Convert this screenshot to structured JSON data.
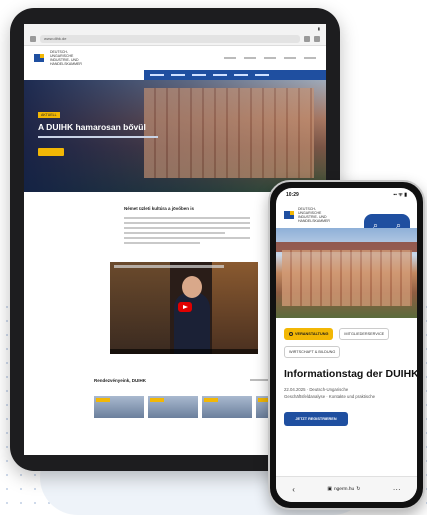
{
  "tablet": {
    "url": "www.dihk.de",
    "logo_text": "DEUTSCH-UNGARISCHE INDUSTRIE- UND HANDELSKAMMER",
    "hero_badge": "AKTUELL",
    "hero_title": "A DUIHK hamarosan bővül",
    "content_heading": "Német üzleti kultúra a jövőben is",
    "section_title": "Rendezvényeink, DUIHK"
  },
  "phone": {
    "time": "10:29",
    "signal": "▪▪ ᯤ ▮",
    "logo_text": "DEUTSCH-UNGARISCHE INDUSTRIE- UND HANDELSKAMMER",
    "search_icon": "⌕",
    "search_icon2": "⌕",
    "tag_active": "VERANSTALTUNG",
    "tag_2": "MITGLIEDERSERVICE",
    "tag_3": "WIRTSCHAFT & BILDUNG",
    "title": "Informationstag der DUIHK",
    "desc_line1": "22.04.2025 · Deutsch-Ungarische",
    "desc_line2": "Geschäftsfeldanalyse · Kontakte und praktische",
    "button_label": "JETZT REGISTRIEREN",
    "browser_back": "‹",
    "browser_url": "ngerm.hu",
    "browser_reload": "↻",
    "browser_more": "···"
  },
  "colors": {
    "brand_blue": "#1f4fa0",
    "accent_yellow": "#f2b705"
  }
}
